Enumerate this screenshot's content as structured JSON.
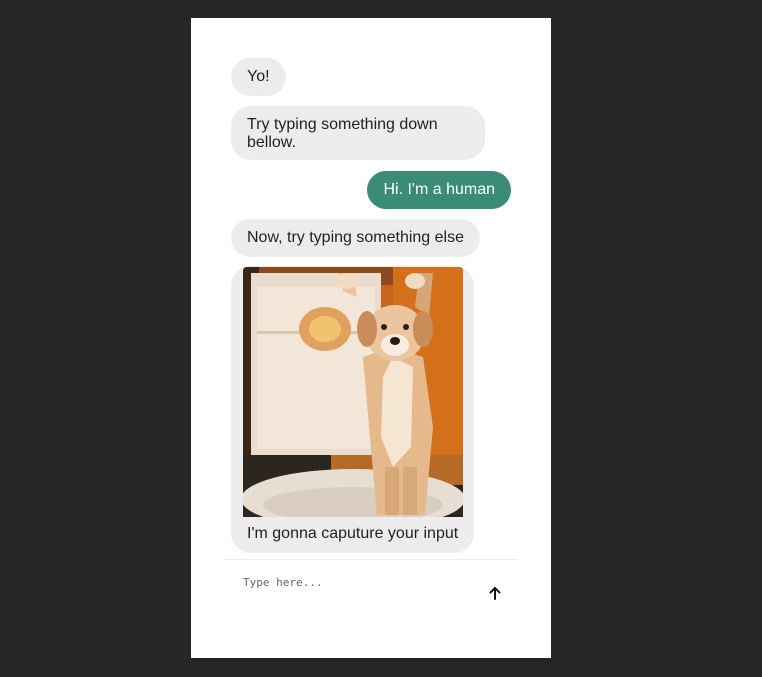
{
  "messages": [
    {
      "from": "bot",
      "text": "Yo!"
    },
    {
      "from": "bot",
      "text": "Try typing something down bellow."
    },
    {
      "from": "user",
      "text": "Hi. I'm a human"
    },
    {
      "from": "bot",
      "text": "Now, try typing something else"
    },
    {
      "from": "bot",
      "image": "dancing-puppy-gif",
      "text": "I'm gonna caputure your input"
    }
  ],
  "composer": {
    "placeholder": "Type here...",
    "send_icon": "arrow-up-icon"
  },
  "colors": {
    "backdrop": "#262626",
    "panel": "#ffffff",
    "bot_bubble": "#ececec",
    "user_bubble": "#3a8c76",
    "user_text": "#ffffff"
  }
}
